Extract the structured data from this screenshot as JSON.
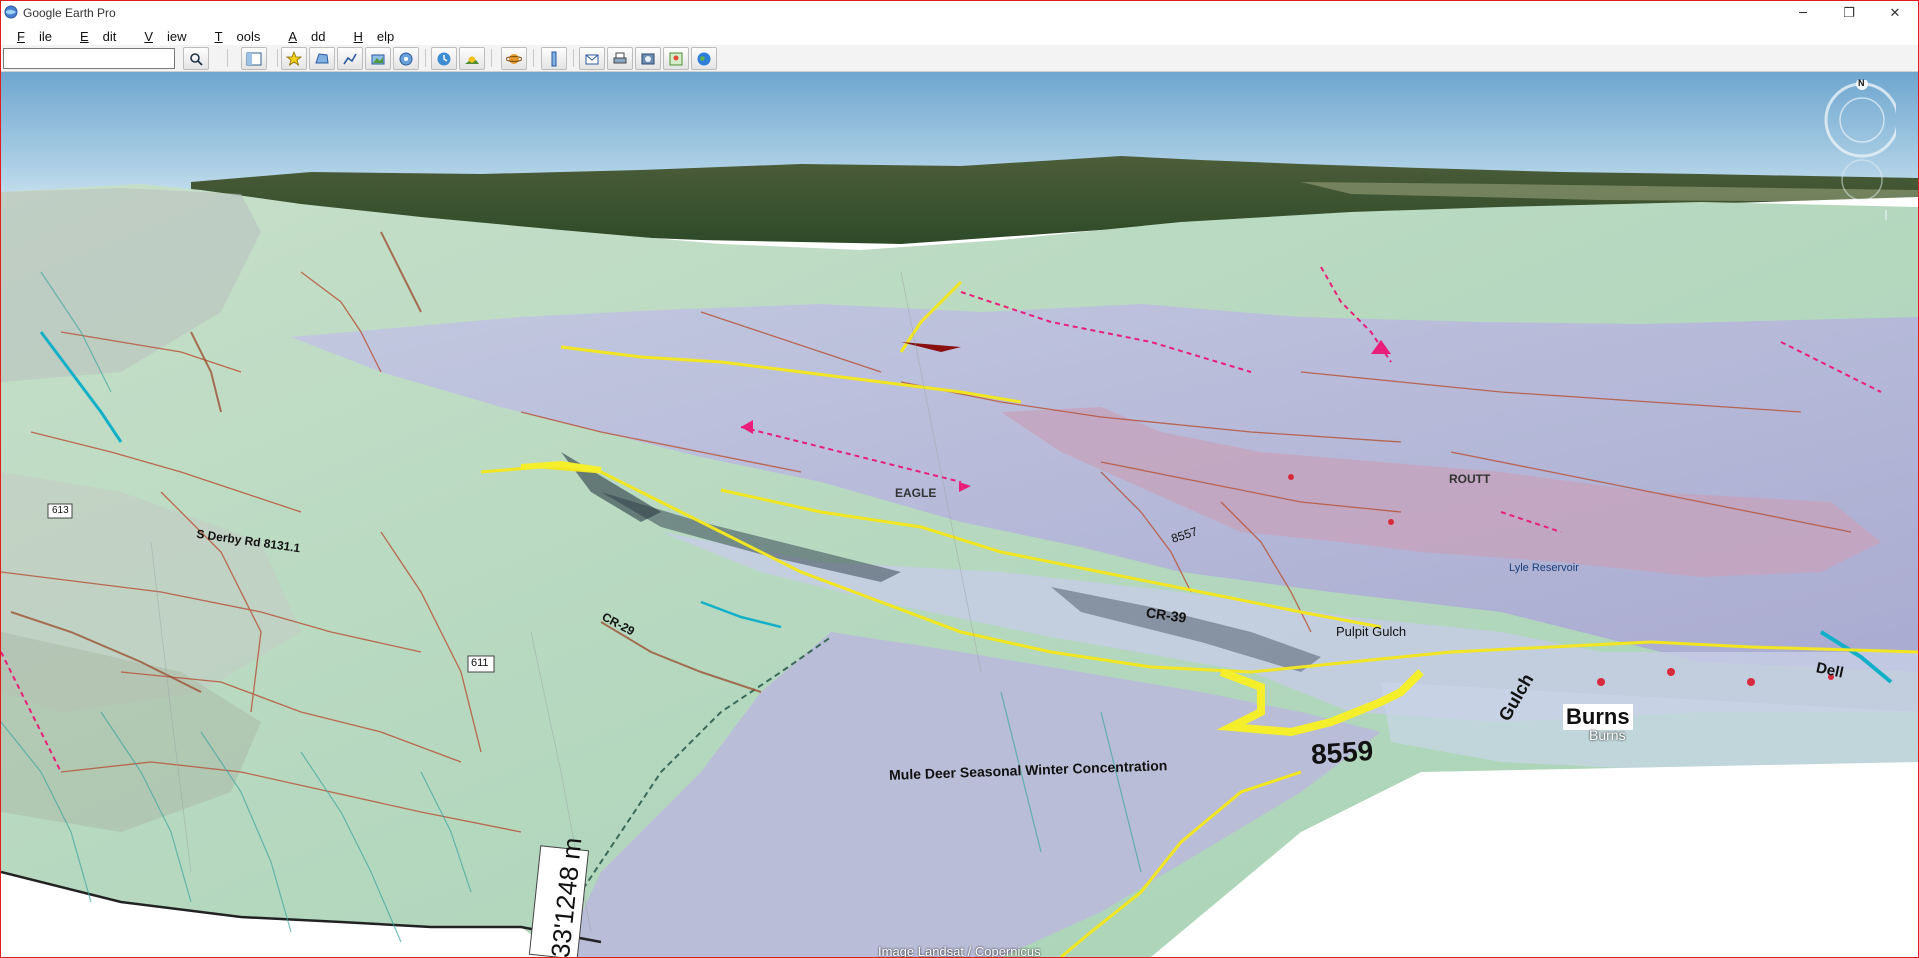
{
  "window": {
    "title": "Google Earth Pro",
    "controls": {
      "minimize": "─",
      "restore": "❐",
      "close": "✕"
    },
    "border_color": "#e21b1b"
  },
  "menu": [
    {
      "label": "File",
      "accel": "F",
      "rest": "ile"
    },
    {
      "label": "Edit",
      "accel": "E",
      "rest": "dit"
    },
    {
      "label": "View",
      "accel": "V",
      "rest": "iew"
    },
    {
      "label": "Tools",
      "accel": "T",
      "rest": "ools"
    },
    {
      "label": "Add",
      "accel": "A",
      "rest": "dd"
    },
    {
      "label": "Help",
      "accel": "H",
      "rest": "elp"
    }
  ],
  "toolbar": {
    "search_value": "",
    "buttons": [
      "search-icon",
      "sidebar-toggle-icon",
      "placemark-icon",
      "polygon-icon",
      "path-icon",
      "image-overlay-icon",
      "record-tour-icon",
      "historical-imagery-icon",
      "sun-icon",
      "planets-icon",
      "ruler-icon",
      "email-icon",
      "print-icon",
      "save-image-icon",
      "view-in-maps-icon",
      "earth-icon"
    ]
  },
  "compass": {
    "north_label": "N"
  },
  "map_labels": {
    "elevation_marker": "33'1248 m",
    "road_613": "613",
    "road_611": "611",
    "cr39": "CR-39",
    "cr8559": "8559",
    "pulpit_gulch": "Pulpit Gulch",
    "eagle": "EAGLE",
    "routt": "ROUTT",
    "burns_big": "Burns",
    "burns_small": "Burns",
    "dell": "Dell",
    "mule_deer": "Mule Deer Seasonal Winter Concentration",
    "road_8557": "8557",
    "lyle_reservoir": "Lyle Reservoir",
    "s_derby_rd": "S Derby Rd 8131.1",
    "cr_29": "CR-29",
    "gulch": "Gulch"
  },
  "attribution": "Image Landsat / Copernicus"
}
